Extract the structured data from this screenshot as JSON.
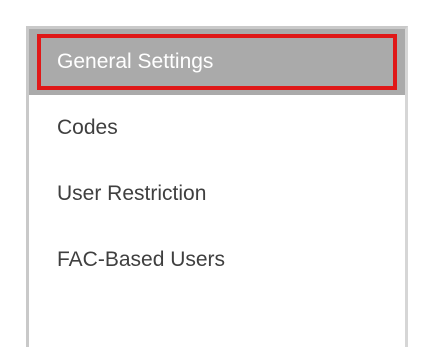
{
  "sidebar": {
    "items": [
      {
        "label": "General Settings",
        "active": true
      },
      {
        "label": "Codes",
        "active": false
      },
      {
        "label": "User Restriction",
        "active": false
      },
      {
        "label": "FAC-Based Users",
        "active": false
      }
    ]
  },
  "colors": {
    "active_background": "#aaaaaa",
    "highlight_outline": "#e01818",
    "text": "#3f3f3f",
    "panel_border": "#c9c9c9"
  }
}
